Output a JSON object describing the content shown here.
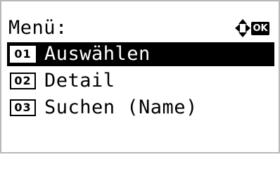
{
  "screen": {
    "title": "Menü:",
    "nav_icon": "four-way-arrow-icon",
    "ok_label": "OK"
  },
  "menu": {
    "items": [
      {
        "number": "01",
        "label": "Auswählen",
        "selected": true
      },
      {
        "number": "02",
        "label": "Detail",
        "selected": false
      },
      {
        "number": "03",
        "label": "Suchen (Name)",
        "selected": false
      }
    ]
  },
  "colors": {
    "background": "#ffffff",
    "text": "#000000",
    "highlight": "#000000",
    "frame": "#b8b8b8"
  }
}
